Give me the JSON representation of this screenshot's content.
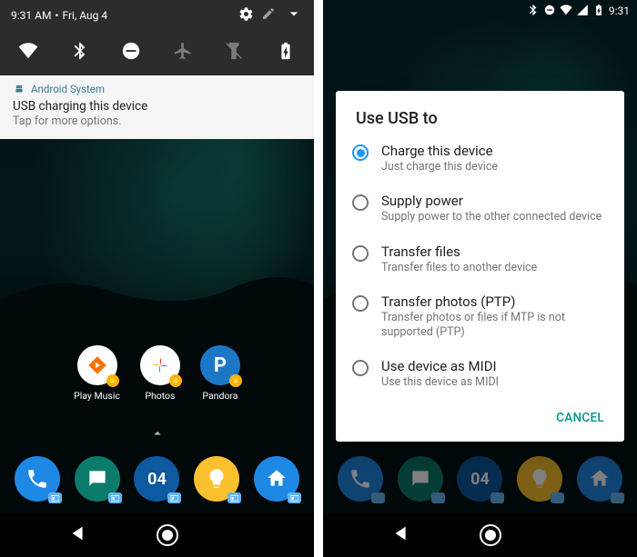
{
  "left": {
    "status": {
      "time": "9:31 AM",
      "date": "Fri, Aug 4"
    },
    "qs_icons": [
      "wifi",
      "bluetooth",
      "dnd",
      "airplane",
      "flashlight",
      "battery-charging"
    ],
    "notif": {
      "app": "Android System",
      "title": "USB charging this device",
      "sub": "Tap for more options."
    },
    "apps": [
      {
        "name": "Play Music",
        "bg": "#ffffff",
        "fg": "#ff6f00"
      },
      {
        "name": "Photos",
        "bg": "#ffffff",
        "fg": "#4285f4"
      },
      {
        "name": "Pandora",
        "bg": "#1d77c7",
        "fg": "#ffffff",
        "letter": "P"
      }
    ],
    "dock": [
      {
        "name": "phone",
        "bg": "#1e88e5"
      },
      {
        "name": "messages",
        "bg": "#0d7b6c"
      },
      {
        "name": "calendar",
        "bg": "#0d5aa0",
        "text": "04"
      },
      {
        "name": "assistant",
        "bg": "#fbc02d"
      },
      {
        "name": "home",
        "bg": "#1e88e5"
      }
    ]
  },
  "right": {
    "status": {
      "time": "9:31"
    },
    "dialog": {
      "title": "Use USB to",
      "items": [
        {
          "label": "Charge this device",
          "sub": "Just charge this device",
          "checked": true
        },
        {
          "label": "Supply power",
          "sub": "Supply power to the other connected device",
          "checked": false
        },
        {
          "label": "Transfer files",
          "sub": "Transfer files to another device",
          "checked": false
        },
        {
          "label": "Transfer photos (PTP)",
          "sub": "Transfer photos or files if MTP is not supported (PTP)",
          "checked": false
        },
        {
          "label": "Use device as MIDI",
          "sub": "Use this device as MIDI",
          "checked": false
        }
      ],
      "cancel": "CANCEL"
    },
    "dock": [
      {
        "name": "phone",
        "bg": "#1e88e5"
      },
      {
        "name": "messages",
        "bg": "#0d7b6c"
      },
      {
        "name": "calendar",
        "bg": "#0d5aa0",
        "text": "04"
      },
      {
        "name": "assistant",
        "bg": "#fbc02d"
      },
      {
        "name": "home",
        "bg": "#1e88e5"
      }
    ]
  }
}
